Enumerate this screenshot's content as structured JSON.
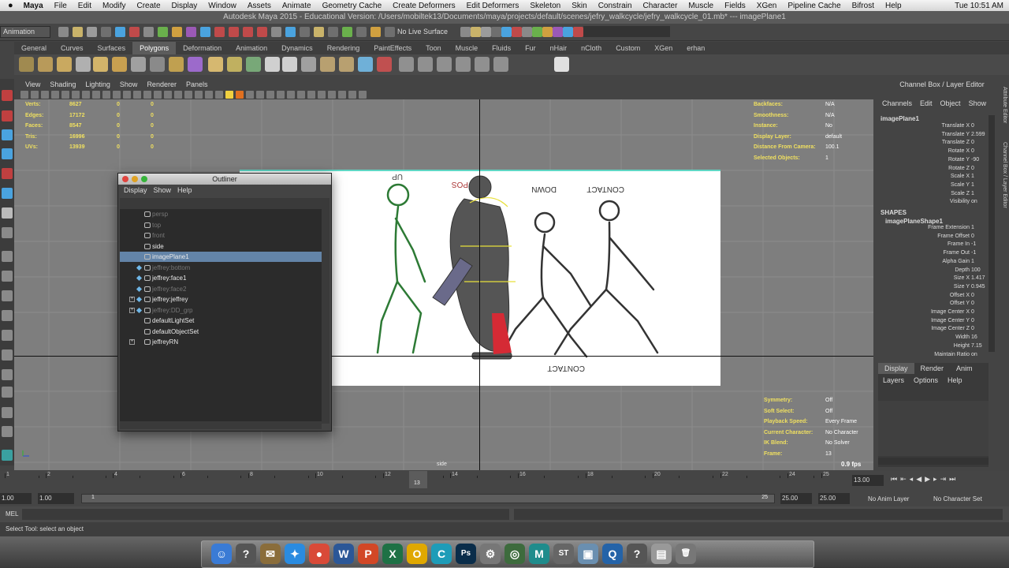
{
  "mac_menu": {
    "app": "Maya",
    "items": [
      "File",
      "Edit",
      "Modify",
      "Create",
      "Display",
      "Window",
      "Assets",
      "Animate",
      "Geometry Cache",
      "Create Deformers",
      "Edit Deformers",
      "Skeleton",
      "Skin",
      "Constrain",
      "Character",
      "Muscle",
      "Fields",
      "XGen",
      "Pipeline Cache",
      "Bifrost",
      "Help"
    ],
    "clock": "Tue 10:51 AM"
  },
  "window_title": "Autodesk Maya 2015 - Educational Version: /Users/mobiltek13/Documents/maya/projects/default/scenes/jefry_walkcycle/jefry_walkcycle_01.mb*  ---  imagePlane1",
  "status_line": {
    "mode": "Animation",
    "live_surface": "No Live Surface"
  },
  "shelf": {
    "tabs": [
      "General",
      "Curves",
      "Surfaces",
      "Polygons",
      "Deformation",
      "Animation",
      "Dynamics",
      "Rendering",
      "PaintEffects",
      "Toon",
      "Muscle",
      "Fluids",
      "Fur",
      "nHair",
      "nCloth",
      "Custom",
      "XGen",
      "erhan"
    ],
    "active": "Polygons"
  },
  "viewport": {
    "menu": [
      "View",
      "Shading",
      "Lighting",
      "Show",
      "Renderer",
      "Panels"
    ],
    "camera_label": "side",
    "fps": "0.9 fps",
    "poly_stats": {
      "rows": [
        {
          "label": "Verts:",
          "v1": "8627",
          "v2": "0",
          "v3": "0"
        },
        {
          "label": "Edges:",
          "v1": "17172",
          "v2": "0",
          "v3": "0"
        },
        {
          "label": "Faces:",
          "v1": "8547",
          "v2": "0",
          "v3": "0"
        },
        {
          "label": "Tris:",
          "v1": "16996",
          "v2": "0",
          "v3": "0"
        },
        {
          "label": "UVs:",
          "v1": "13939",
          "v2": "0",
          "v3": "0"
        }
      ]
    },
    "hud_right": {
      "rows": [
        {
          "label": "Backfaces:",
          "value": "N/A"
        },
        {
          "label": "Smoothness:",
          "value": "N/A"
        },
        {
          "label": "Instance:",
          "value": "No"
        },
        {
          "label": "Display Layer:",
          "value": "default"
        },
        {
          "label": "Distance From Camera:",
          "value": "100.1"
        },
        {
          "label": "Selected Objects:",
          "value": "1"
        }
      ]
    },
    "hud_bottom": {
      "rows": [
        {
          "label": "Symmetry:",
          "value": "Off"
        },
        {
          "label": "Soft Select:",
          "value": "Off"
        },
        {
          "label": "Playback Speed:",
          "value": "Every Frame"
        },
        {
          "label": "Current Character:",
          "value": "No Character"
        },
        {
          "label": "IK Blend:",
          "value": "No Solver"
        },
        {
          "label": "Frame:",
          "value": "13"
        }
      ]
    },
    "sketch_labels": [
      "UP",
      "POS",
      "DOWN",
      "CONTACT",
      "CONTACT"
    ]
  },
  "outliner": {
    "title": "Outliner",
    "menu": [
      "Display",
      "Show",
      "Help"
    ],
    "items": [
      {
        "label": "persp",
        "dim": true
      },
      {
        "label": "top",
        "dim": true
      },
      {
        "label": "front",
        "dim": true
      },
      {
        "label": "side",
        "dim": false
      },
      {
        "label": "imagePlane1",
        "dim": false,
        "selected": true
      },
      {
        "label": "jeffrey:bottom",
        "dim": true
      },
      {
        "label": "jeffrey:face1",
        "dim": false
      },
      {
        "label": "jeffrey:face2",
        "dim": true
      },
      {
        "label": "jeffrey:jeffrey",
        "dim": false,
        "expand": "+"
      },
      {
        "label": "jeffrey:DD_grp",
        "dim": true,
        "expand": "+"
      },
      {
        "label": "defaultLightSet",
        "dim": false
      },
      {
        "label": "defaultObjectSet",
        "dim": false
      },
      {
        "label": "jeffreyRN",
        "dim": false,
        "expand": "+"
      }
    ]
  },
  "channel_box": {
    "title": "Channel Box / Layer Editor",
    "tabs": [
      "Channels",
      "Edit",
      "Object",
      "Show"
    ],
    "node": "imagePlane1",
    "attrs": [
      {
        "label": "Translate X",
        "value": "0"
      },
      {
        "label": "Translate Y",
        "value": "2.599"
      },
      {
        "label": "Translate Z",
        "value": "0"
      },
      {
        "label": "Rotate X",
        "value": "0"
      },
      {
        "label": "Rotate Y",
        "value": "-90"
      },
      {
        "label": "Rotate Z",
        "value": "0"
      },
      {
        "label": "Scale X",
        "value": "1"
      },
      {
        "label": "Scale Y",
        "value": "1"
      },
      {
        "label": "Scale Z",
        "value": "1"
      },
      {
        "label": "Visibility",
        "value": "on"
      }
    ],
    "shapes_header": "SHAPES",
    "shape_node": "imagePlaneShape1",
    "shape_attrs": [
      {
        "label": "Frame Extension",
        "value": "1"
      },
      {
        "label": "Frame Offset",
        "value": "0"
      },
      {
        "label": "Frame In",
        "value": "-1"
      },
      {
        "label": "Frame Out",
        "value": "-1"
      },
      {
        "label": "Alpha Gain",
        "value": "1"
      },
      {
        "label": "Depth",
        "value": "100"
      },
      {
        "label": "Size X",
        "value": "1.417"
      },
      {
        "label": "Size Y",
        "value": "0.945"
      },
      {
        "label": "Offset X",
        "value": "0"
      },
      {
        "label": "Offset Y",
        "value": "0"
      },
      {
        "label": "Image Center X",
        "value": "0"
      },
      {
        "label": "Image Center Y",
        "value": "0"
      },
      {
        "label": "Image Center Z",
        "value": "0"
      },
      {
        "label": "Width",
        "value": "16"
      },
      {
        "label": "Height",
        "value": "7.15"
      },
      {
        "label": "Maintain Ratio",
        "value": "on"
      }
    ],
    "side_tabs": [
      "Attribute Editor",
      "Channel Box / Layer Editor"
    ]
  },
  "layer_editor": {
    "tabs": [
      "Display",
      "Render",
      "Anim"
    ],
    "menu": [
      "Layers",
      "Options",
      "Help"
    ]
  },
  "time_slider": {
    "ticks": [
      "1",
      "2",
      "4",
      "6",
      "8",
      "10",
      "12",
      "13",
      "14",
      "16",
      "18",
      "20",
      "22",
      "24",
      "25"
    ],
    "current": "13",
    "current_field": "13.00"
  },
  "range": {
    "start": "1.00",
    "start2": "1.00",
    "range_start": "1",
    "range_end": "25",
    "end": "25.00",
    "end2": "25.00",
    "anim_layer": "No Anim Layer",
    "character_set": "No Character Set"
  },
  "command_line": {
    "label": "MEL"
  },
  "help_line": "Select Tool: select an object",
  "dock": {
    "apps": [
      {
        "name": "finder",
        "glyph": "☺",
        "color": "#3a7bd5"
      },
      {
        "name": "help",
        "glyph": "?",
        "color": "#555555"
      },
      {
        "name": "mail-app",
        "glyph": "✉",
        "color": "#8a6d3b"
      },
      {
        "name": "safari",
        "glyph": "✦",
        "color": "#2a8be0"
      },
      {
        "name": "chrome",
        "glyph": "●",
        "color": "#d94a38"
      },
      {
        "name": "word",
        "glyph": "W",
        "color": "#2b5797"
      },
      {
        "name": "powerpoint",
        "glyph": "P",
        "color": "#d24726"
      },
      {
        "name": "excel",
        "glyph": "X",
        "color": "#1e7145"
      },
      {
        "name": "outlook",
        "glyph": "O",
        "color": "#e0a800"
      },
      {
        "name": "onenote",
        "glyph": "C",
        "color": "#1e9cb8"
      },
      {
        "name": "photoshop",
        "glyph": "Ps",
        "color": "#0a2d4a"
      },
      {
        "name": "system-prefs",
        "glyph": "⚙",
        "color": "#777777"
      },
      {
        "name": "quicktime",
        "glyph": "◎",
        "color": "#3d6b3d"
      },
      {
        "name": "maya",
        "glyph": "M",
        "color": "#1f8c8c"
      },
      {
        "name": "stickies",
        "glyph": "ST",
        "color": "#666666"
      },
      {
        "name": "preview",
        "glyph": "▣",
        "color": "#6a8fb0"
      },
      {
        "name": "quicktime-player",
        "glyph": "Q",
        "color": "#2463a8"
      },
      {
        "name": "help-2",
        "glyph": "?",
        "color": "#555555"
      },
      {
        "name": "document",
        "glyph": "▤",
        "color": "#999999"
      },
      {
        "name": "trash",
        "glyph": "🗑",
        "color": "#777777"
      }
    ]
  }
}
